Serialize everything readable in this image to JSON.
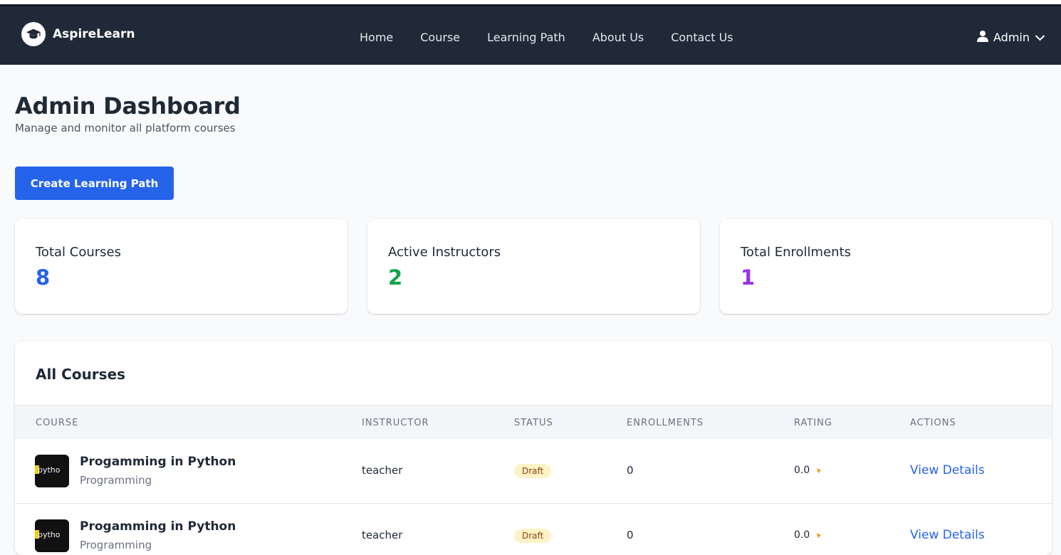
{
  "brand": {
    "name": "AspireLearn",
    "logo_icon": "graduation-cap-icon"
  },
  "nav": {
    "links": [
      "Home",
      "Course",
      "Learning Path",
      "About Us",
      "Contact Us"
    ]
  },
  "user": {
    "label": "Admin",
    "icon": "user-icon",
    "dropdown_icon": "chevron-down-icon"
  },
  "page": {
    "title": "Admin Dashboard",
    "subtitle": "Manage and monitor all platform courses"
  },
  "actions": {
    "create_label": "Create Learning Path"
  },
  "stats": [
    {
      "label": "Total Courses",
      "value": "8",
      "color": "#2563eb"
    },
    {
      "label": "Active Instructors",
      "value": "2",
      "color": "#16a34a"
    },
    {
      "label": "Total Enrollments",
      "value": "1",
      "color": "#9333ea"
    }
  ],
  "courses": {
    "title": "All Courses",
    "columns": [
      "COURSE",
      "INSTRUCTOR",
      "STATUS",
      "ENROLLMENTS",
      "RATING",
      "ACTIONS"
    ],
    "rows": [
      {
        "name": "Progamming in Python",
        "category": "Programming",
        "thumb_text": "pytho",
        "instructor": "teacher",
        "status": "Draft",
        "enrollments": "0",
        "rating": "0.0",
        "action": "View Details"
      },
      {
        "name": "Progamming in Python",
        "category": "Programming",
        "thumb_text": "pytho",
        "instructor": "teacher",
        "status": "Draft",
        "enrollments": "0",
        "rating": "0.0",
        "action": "View Details"
      }
    ]
  },
  "colors": {
    "nav_bg": "#1f2937",
    "primary": "#2563eb",
    "star": "#f59e0b"
  }
}
